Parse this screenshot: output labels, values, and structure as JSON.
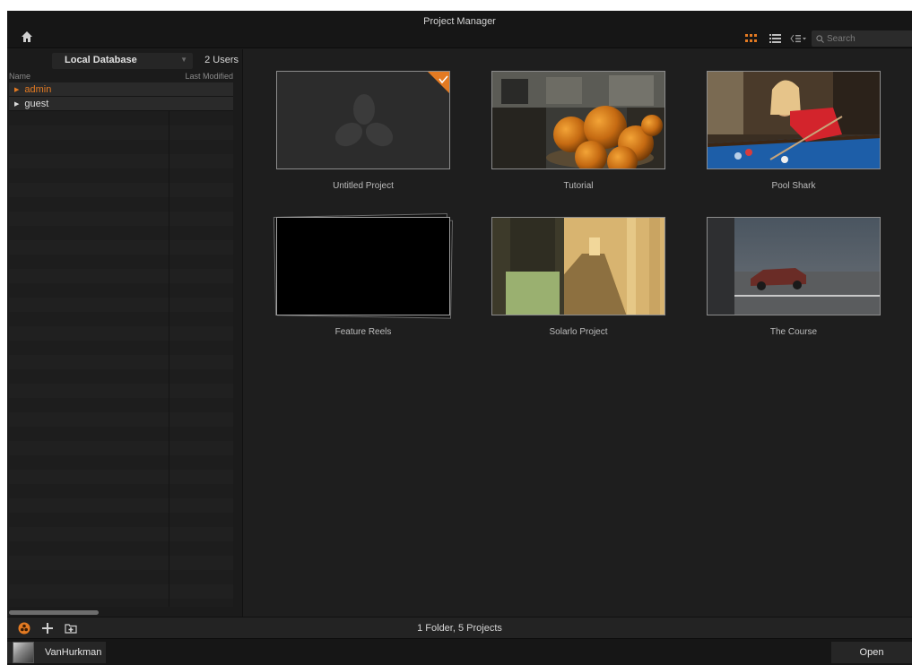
{
  "window": {
    "title": "Project Manager"
  },
  "toolbar": {
    "home_icon": "home-icon",
    "grid_view_icon": "grid-view-icon",
    "list_view_icon": "list-view-icon",
    "sort_icon": "sort-icon",
    "search_placeholder": "Search",
    "accent": "#e37a22"
  },
  "sidebar": {
    "database_label": "Local Database",
    "user_count": "2 Users",
    "columns": [
      "Name",
      "Last Modified"
    ],
    "users": [
      {
        "name": "admin",
        "active": true
      },
      {
        "name": "guest",
        "active": false
      }
    ]
  },
  "projects": [
    {
      "name": "Untitled Project",
      "type": "project",
      "selected": true
    },
    {
      "name": "Tutorial",
      "type": "project",
      "selected": false
    },
    {
      "name": "Pool Shark",
      "type": "project",
      "selected": false
    },
    {
      "name": "Feature Reels",
      "type": "folder",
      "selected": false
    },
    {
      "name": "Solarlo Project",
      "type": "project",
      "selected": false
    },
    {
      "name": "The Course",
      "type": "project",
      "selected": false
    }
  ],
  "statusbar": {
    "summary": "1 Folder, 5 Projects"
  },
  "footer": {
    "user_name": "VanHurkman",
    "open_label": "Open"
  }
}
